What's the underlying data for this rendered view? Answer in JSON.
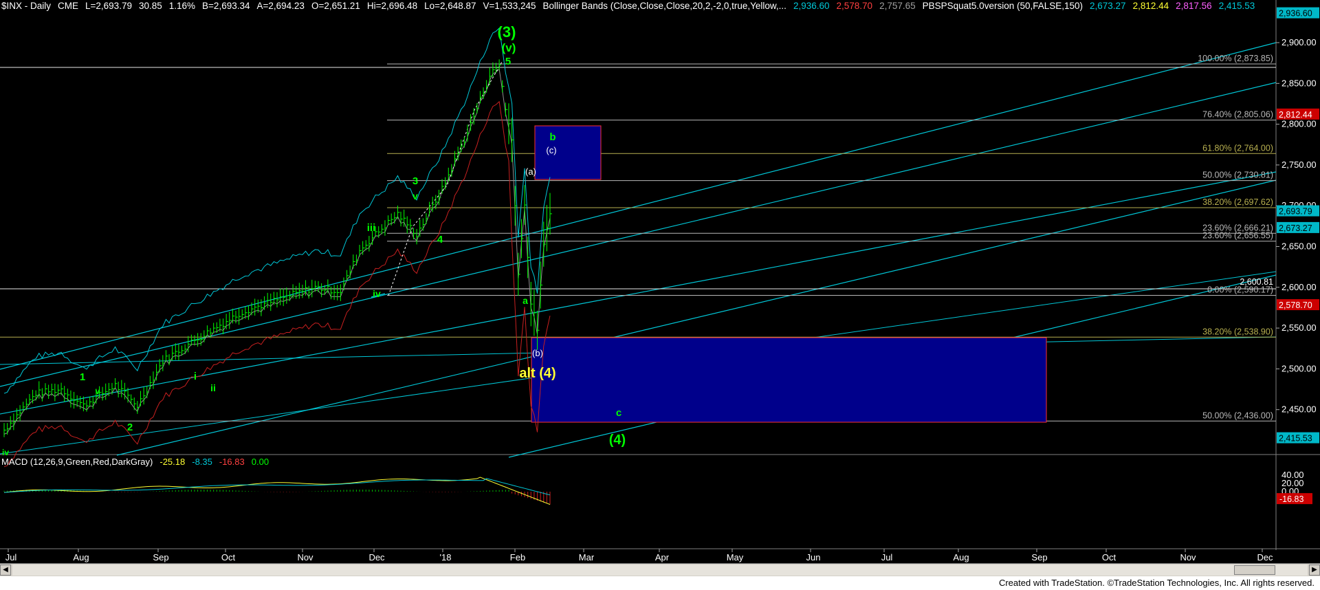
{
  "header": {
    "symbol": "$INX - Daily",
    "exchange": "CME",
    "last": "L=2,693.79",
    "change": "30.85",
    "change_pct": "1.16%",
    "bid": "B=2,693.34",
    "ask": "A=2,694.23",
    "open": "O=2,651.21",
    "high": "Hi=2,696.48",
    "low": "Lo=2,648.87",
    "volume": "V=1,533,245",
    "bb_label": "Bollinger Bands (Close,Close,Close,20,2,-2,0,true,Yellow,...",
    "bb_upper": "2,936.60",
    "bb_lower": "2,578.70",
    "bb_mid": "2,757.65",
    "ind_label": "PBSPSquat5.0version (50,FALSE,150)",
    "ind_v1": "2,673.27",
    "ind_v2": "2,812.44",
    "ind_v3": "2,817.56",
    "ind_v4": "2,415.53"
  },
  "macd_header": {
    "label": "MACD (12,26,9,Green,Red,DarkGray)",
    "v1": "-25.18",
    "v2": "-8.35",
    "v3": "-16.83",
    "v4": "0.00"
  },
  "footer": {
    "credit": "Created with TradeStation. ©TradeStation Technologies, Inc. All rights reserved."
  },
  "colors": {
    "background": "#000000",
    "bar": "#00ff00",
    "channel": "#00c8d8",
    "fib": "#b8b8b8",
    "wave_green": "#00ff00",
    "box_fill": "#00008b",
    "box_border": "#ff3030",
    "highlight_yellow": "#ffff33",
    "price_tag": "#00b8c8"
  },
  "chart_data": {
    "type": "candlestick",
    "ylim": [
      2400,
      2950
    ],
    "macd_ylim": [
      -30,
      50
    ],
    "x_tick_labels": [
      "Jul",
      "Aug",
      "Sep",
      "Oct",
      "Nov",
      "Dec",
      "'18",
      "Feb",
      "Mar",
      "Apr",
      "May",
      "Jun",
      "Jul",
      "Aug",
      "Sep",
      "Oct",
      "Nov",
      "Dec"
    ],
    "y_tick_labels": [
      "2,900.00",
      "2,850.00",
      "2,800.00",
      "2,750.00",
      "2,700.00",
      "2,650.00",
      "2,600.00",
      "2,550.00",
      "2,500.00",
      "2,450.00"
    ],
    "macd_tick_labels": [
      "40.00",
      "20.00",
      "0.00"
    ],
    "price_tags": [
      {
        "value": 2936.6,
        "label": "2,936.60",
        "color": "#00b8c8"
      },
      {
        "value": 2812.44,
        "label": "2,812.44",
        "color": "#cc0000"
      },
      {
        "value": 2693.79,
        "label": "2,693.79",
        "color": "#00b8c8"
      },
      {
        "value": 2673.27,
        "label": "2,673.27",
        "color": "#00b8c8"
      },
      {
        "value": 2578.7,
        "label": "2,578.70",
        "color": "#cc0000"
      },
      {
        "value": 2415.53,
        "label": "2,415.53",
        "color": "#00b8c8"
      }
    ],
    "macd_tag": {
      "value": -16.83,
      "label": "-16.83"
    },
    "fib_levels": [
      {
        "label": "100.00% (2,873.85)",
        "value": 2873.85
      },
      {
        "label": "76.40% (2,805.06)",
        "value": 2805.06
      },
      {
        "label": "61.80% (2,764.00)",
        "value": 2764.0
      },
      {
        "label": "50.00% (2,730.81)",
        "value": 2730.81
      },
      {
        "label": "38.20% (2,697.62)",
        "value": 2697.62
      },
      {
        "label": "23.60% (2,666.21)",
        "value": 2666.21
      },
      {
        "label": "23.60% (2,656.55)",
        "value": 2656.55
      },
      {
        "label": "0.00% (2,590.17)",
        "value": 2590.17
      },
      {
        "label": "38.20% (2,538.90)",
        "value": 2538.9
      },
      {
        "label": "50.00% (2,436.00)",
        "value": 2436.0
      }
    ],
    "extra_level_label": "2,600.81",
    "wave_labels": [
      "(3)",
      "(v)",
      "5",
      "3",
      "v",
      "iii",
      "4",
      "iv",
      "1",
      "v",
      "i",
      "ii",
      "2",
      "iv",
      "a",
      "(b)",
      "(a)",
      "(c)",
      "b",
      "alt (4)",
      "c",
      "(4)"
    ]
  }
}
